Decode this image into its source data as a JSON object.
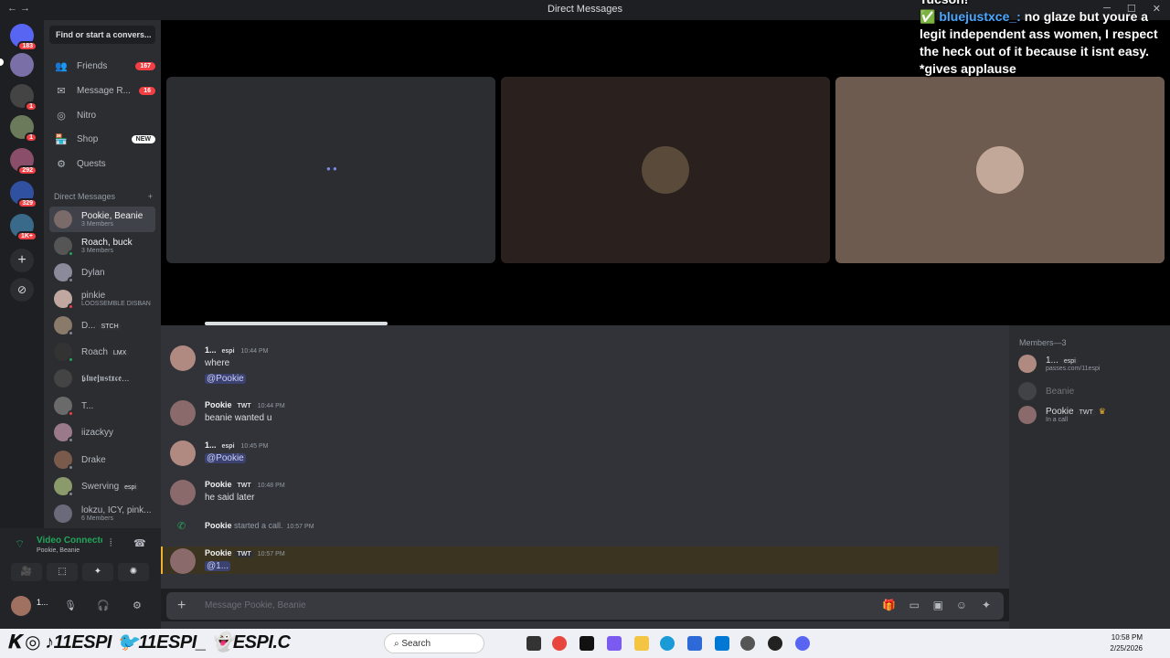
{
  "window": {
    "title": "Direct Messages",
    "nav": "← →"
  },
  "servers": [
    {
      "badge": "183"
    },
    {
      "badge": ""
    },
    {
      "badge": "1"
    },
    {
      "badge": "1"
    },
    {
      "badge": "292"
    },
    {
      "badge": "329"
    },
    {
      "badge": "1K+"
    }
  ],
  "sidebar": {
    "search_placeholder": "Find or start a convers...",
    "nav": [
      {
        "label": "Friends",
        "badge": "167",
        "icon": "👥"
      },
      {
        "label": "Message R...",
        "badge": "16",
        "icon": "✉"
      },
      {
        "label": "Nitro",
        "badge": "",
        "icon": "◎"
      },
      {
        "label": "Shop",
        "badge": "NEW",
        "icon": "🏪"
      },
      {
        "label": "Quests",
        "badge": "",
        "icon": "⚙"
      }
    ],
    "dm_header": "Direct Messages",
    "dm_add": "+",
    "dms": [
      {
        "name": "Pookie, Beanie",
        "sub": "3 Members",
        "tag": ""
      },
      {
        "name": "Roach, buck",
        "sub": "3 Members",
        "tag": ""
      },
      {
        "name": "Dylan",
        "sub": "",
        "tag": ""
      },
      {
        "name": "pinkie",
        "sub": "LOOSSEMBLE DISBAN",
        "tag": ""
      },
      {
        "name": "D...",
        "sub": "",
        "tag": "STCH"
      },
      {
        "name": "Roach",
        "sub": "",
        "tag": "LMX"
      },
      {
        "name": "𝖇𝖑𝖚𝖊𝖏𝖚𝖘𝖙𝖝𝖈𝖊...",
        "sub": "",
        "tag": ""
      },
      {
        "name": "T...",
        "sub": "",
        "tag": ""
      },
      {
        "name": "iizackyy",
        "sub": "",
        "tag": ""
      },
      {
        "name": "Drake",
        "sub": "",
        "tag": ""
      },
      {
        "name": "Swerving",
        "sub": "",
        "tag": "espi"
      },
      {
        "name": "lokzu, ICY, pink...",
        "sub": "6 Members",
        "tag": ""
      }
    ]
  },
  "voice": {
    "title": "Video Connected",
    "sub": "Pookie, Beanie",
    "user": "1...",
    "buttons": [
      "🎥",
      "⬚",
      "✦",
      "✺"
    ]
  },
  "overlay": {
    "top": "Tucson!",
    "username": "bluejustxce_:",
    "text_1": " no glaze but youre a legit independent ass women, I respect the heck out of it because it isnt easy. *gives applause"
  },
  "chat": {
    "messages": [
      {
        "name": "1...",
        "tag": "espi",
        "time": "10:44 PM",
        "lines": [
          "where",
          "@Pookie"
        ]
      },
      {
        "name": "Pookie",
        "tag": "TWT",
        "time": "10:44 PM",
        "lines": [
          "beanie wanted u"
        ]
      },
      {
        "name": "1...",
        "tag": "espi",
        "time": "10:45 PM",
        "lines": [
          "@Pookie"
        ]
      },
      {
        "name": "Pookie",
        "tag": "TWT",
        "time": "10:48 PM",
        "lines": [
          "he said later"
        ]
      }
    ],
    "call": {
      "name": "Pookie",
      "text": "started a call.",
      "time": "10:57 PM"
    },
    "last": {
      "name": "Pookie",
      "tag": "TWT",
      "time": "10:57 PM",
      "mention": "@1..."
    },
    "placeholder": "Message Pookie, Beanie"
  },
  "members": {
    "header": "Members—3",
    "list": [
      {
        "name": "1...",
        "tag": "espi",
        "sub": "passes.com/11espi"
      },
      {
        "name": "Beanie",
        "tag": "",
        "sub": ""
      },
      {
        "name": "Pookie",
        "tag": "TWT",
        "sub": "In a call"
      }
    ]
  },
  "taskbar": {
    "social": "𝐊 ◎ ♪11ESPI 🐦11ESPI_ 👻ESPI.C",
    "search": "Search",
    "time": "10:58 PM",
    "date": "2/25/2026"
  },
  "colors": {
    "accent": "#5865f2",
    "online": "#23a55a",
    "dnd": "#f23f43"
  }
}
